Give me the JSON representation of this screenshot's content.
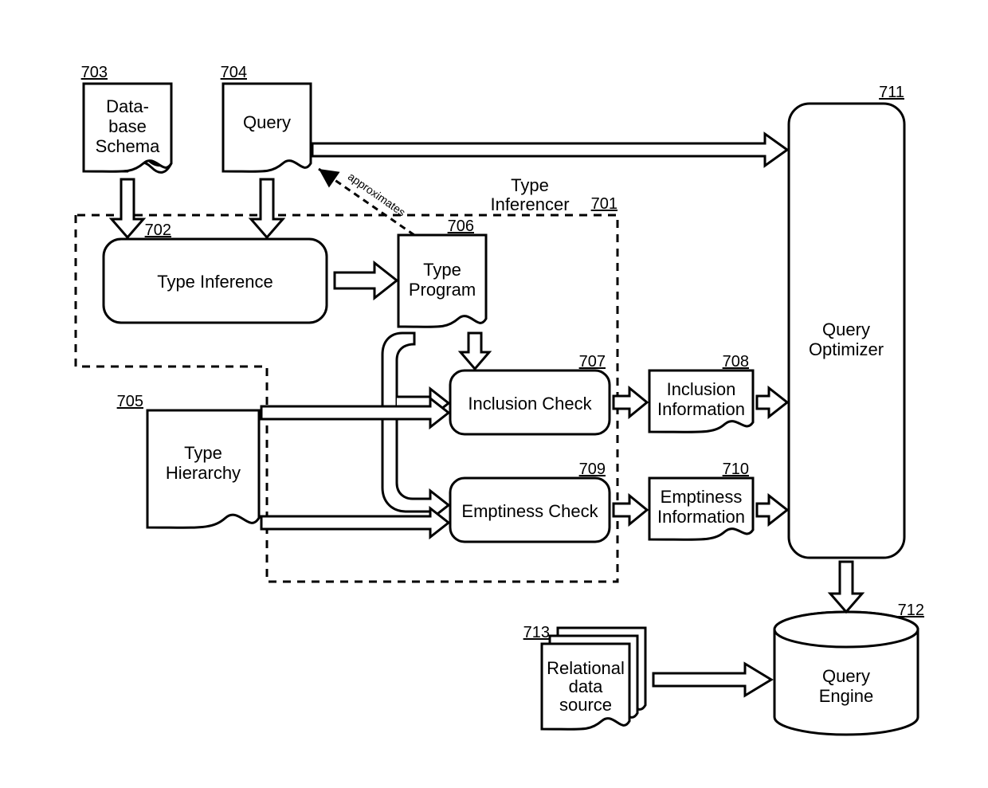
{
  "nodes": {
    "n703": {
      "ref": "703",
      "line1": "Data-",
      "line2": "base",
      "line3": "Schema"
    },
    "n704": {
      "ref": "704",
      "line1": "Query",
      "line2": "",
      "line3": ""
    },
    "n702": {
      "ref": "702",
      "line1": "Type Inference",
      "line2": ""
    },
    "n706": {
      "ref": "706",
      "line1": "Type",
      "line2": "Program"
    },
    "n705": {
      "ref": "705",
      "line1": "Type",
      "line2": "Hierarchy"
    },
    "n707": {
      "ref": "707",
      "line1": "Inclusion Check",
      "line2": ""
    },
    "n709": {
      "ref": "709",
      "line1": "Emptiness Check",
      "line2": ""
    },
    "n708": {
      "ref": "708",
      "line1": "Inclusion",
      "line2": "Information"
    },
    "n710": {
      "ref": "710",
      "line1": "Emptiness",
      "line2": "Information"
    },
    "n711": {
      "ref": "711",
      "line1": "Query",
      "line2": "Optimizer"
    },
    "n712": {
      "ref": "712",
      "line1": "Query",
      "line2": "Engine"
    },
    "n713": {
      "ref": "713",
      "line1": "Relational",
      "line2": "data",
      "line3": "source"
    },
    "n701": {
      "ref": "701",
      "title": "Type",
      "subtitle": "Inferencer"
    }
  },
  "edges": {
    "approx": "approximates"
  }
}
